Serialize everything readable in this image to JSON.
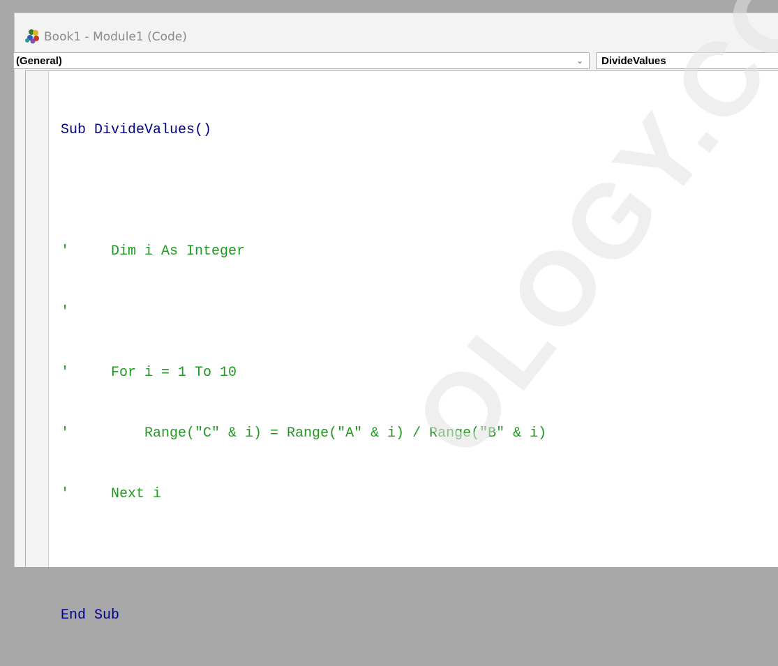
{
  "window": {
    "title": "Book1 - Module1 (Code)",
    "icon": "vba-module-icon"
  },
  "toolbar": {
    "object_value": "(General)",
    "procedure_value": "DivideValues"
  },
  "code": {
    "lines": [
      "Sub DivideValues()",
      "",
      "'     Dim i As Integer",
      "'",
      "'     For i = 1 To 10",
      "'         Range(\"C\" & i) = Range(\"A\" & i) / Range(\"B\" & i)",
      "'     Next i",
      "",
      "End Sub"
    ]
  },
  "colors": {
    "keyword": "#00008b",
    "comment": "#1e9a1e"
  },
  "watermark": {
    "text": "OLOGY.COM"
  }
}
